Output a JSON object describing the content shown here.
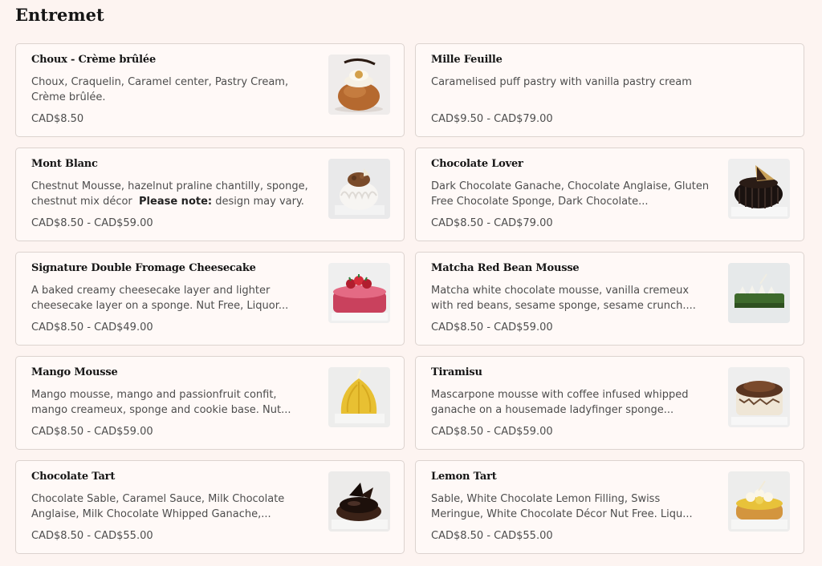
{
  "section": {
    "title": "Entremet"
  },
  "items": [
    {
      "name": "Choux - Crème brûlée",
      "description": "Choux, Craquelin, Caramel center, Pastry Cream, Crème brûlée.",
      "price": "CAD$8.50",
      "image": "choux-cream-puff-image"
    },
    {
      "name": "Mille Feuille",
      "description": "Caramelised puff pastry with vanilla pastry cream",
      "price": "CAD$9.50 - CAD$79.00"
    },
    {
      "name": "Mont Blanc",
      "description": "Chestnut Mousse, hazelnut praline chantilly, sponge, chestnut mix décor",
      "note_label": "Please note:",
      "note_text": "design may vary.",
      "price": "CAD$8.50 - CAD$59.00",
      "image": "mont-blanc-image"
    },
    {
      "name": "Chocolate Lover",
      "description": "Dark Chocolate Ganache, Chocolate Anglaise, Gluten Free Chocolate Sponge, Dark Chocolate...",
      "price": "CAD$8.50 - CAD$79.00",
      "image": "chocolate-lover-image"
    },
    {
      "name": "Signature Double Fromage Cheesecake",
      "description": "A baked creamy cheesecake layer and lighter cheesecake layer on a sponge. Nut Free, Liquor...",
      "price": "CAD$8.50 - CAD$49.00",
      "image": "cheesecake-image"
    },
    {
      "name": "Matcha Red Bean Mousse",
      "description": "Matcha white chocolate mousse, vanilla cremeux with red beans, sesame sponge, sesame crunch....",
      "price": "CAD$8.50 - CAD$59.00",
      "image": "matcha-mousse-image"
    },
    {
      "name": "Mango Mousse",
      "description": "Mango mousse, mango and passionfruit confit, mango creameux, sponge and cookie base. Nut...",
      "price": "CAD$8.50 - CAD$59.00",
      "image": "mango-mousse-image"
    },
    {
      "name": "Tiramisu",
      "description": "Mascarpone mousse with coffee infused whipped ganache on a housemade ladyfinger sponge...",
      "price": "CAD$8.50 - CAD$59.00",
      "image": "tiramisu-image"
    },
    {
      "name": "Chocolate Tart",
      "description": "Chocolate Sable, Caramel Sauce, Milk Chocolate Anglaise, Milk Chocolate Whipped Ganache,...",
      "price": "CAD$8.50 - CAD$55.00",
      "image": "chocolate-tart-image"
    },
    {
      "name": "Lemon Tart",
      "description": "Sable, White Chocolate Lemon Filling, Swiss Meringue, White Chocolate Décor Nut Free. Liqu...",
      "price": "CAD$8.50 - CAD$55.00",
      "image": "lemon-tart-image"
    }
  ],
  "colors": {
    "page_background": "#fdf4f1",
    "card_background": "#fff9f7",
    "card_border": "#dcd3cf",
    "title_text": "#151515",
    "body_text": "#4d4d4d"
  }
}
